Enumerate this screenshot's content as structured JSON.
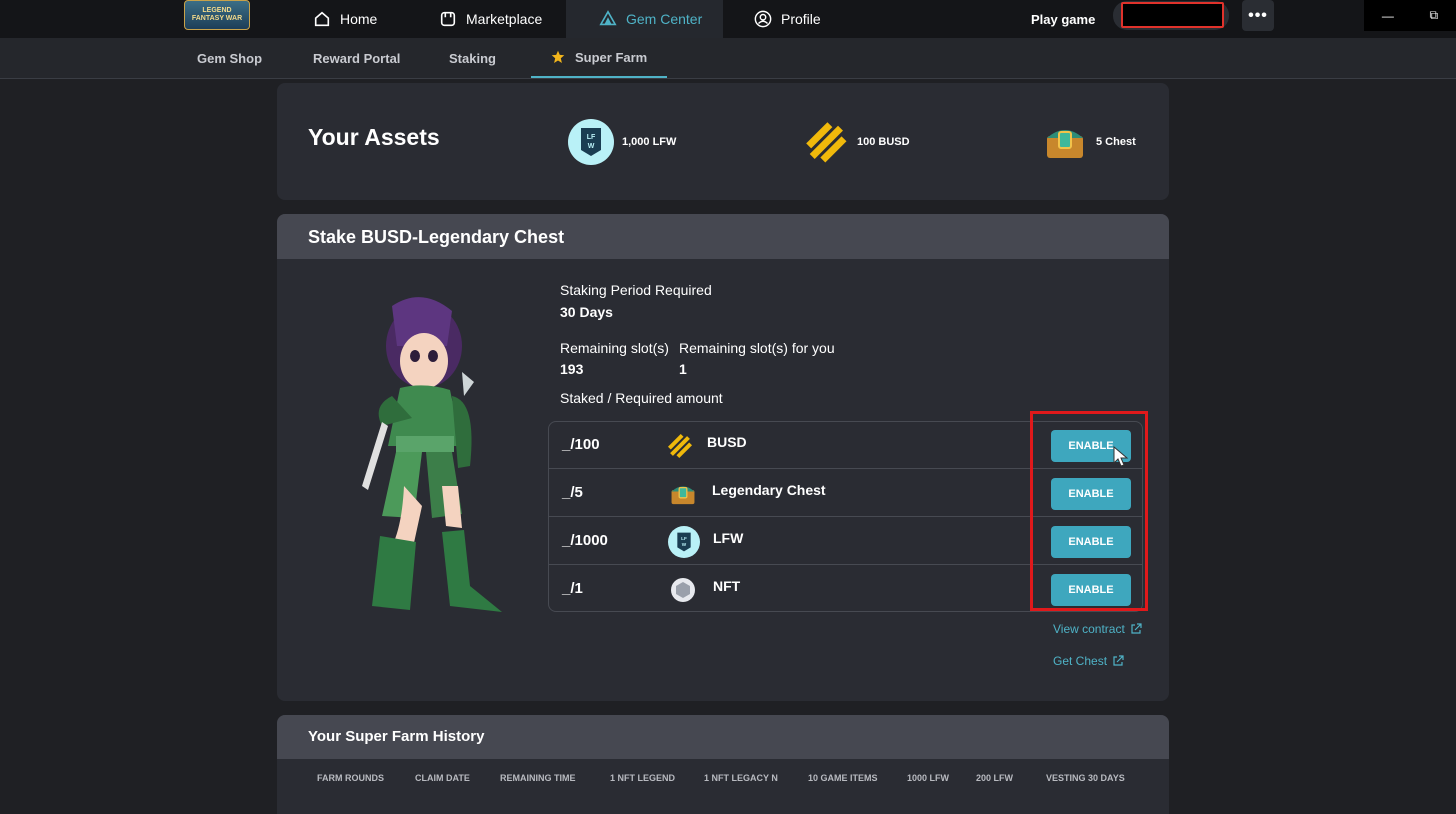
{
  "topbar": {
    "logo_text": "LEGEND FANTASY WAR",
    "nav": [
      {
        "label": "Home",
        "icon": "home-icon"
      },
      {
        "label": "Marketplace",
        "icon": "store-icon"
      },
      {
        "label": "Gem Center",
        "icon": "gem-icon",
        "active": true
      },
      {
        "label": "Profile",
        "icon": "user-icon"
      }
    ],
    "play_label": "Play game",
    "more_label": "•••",
    "window_controls": [
      "—",
      "⧉"
    ]
  },
  "subnav": {
    "items": [
      {
        "label": "Gem Shop"
      },
      {
        "label": "Reward Portal"
      },
      {
        "label": "Staking"
      },
      {
        "label": "Super Farm",
        "active": true,
        "icon": "star-icon"
      }
    ]
  },
  "assets": {
    "title": "Your Assets",
    "items": [
      {
        "label": "1,000 LFW",
        "icon": "lfw-icon"
      },
      {
        "label": "100 BUSD",
        "icon": "busd-icon"
      },
      {
        "label": "5 Chest",
        "icon": "chest-icon"
      }
    ]
  },
  "stake": {
    "title": "Stake BUSD-Legendary Chest",
    "period_label": "Staking Period Required",
    "period_value": "30 Days",
    "remaining_label": "Remaining slot(s)",
    "remaining_value": "193",
    "remaining_you_label": "Remaining slot(s) for you",
    "remaining_you_value": "1",
    "amount_label": "Staked / Required amount",
    "rows": [
      {
        "amount": "_/100",
        "name": "BUSD",
        "icon": "busd-icon",
        "button": "ENABLE"
      },
      {
        "amount": "_/5",
        "name": "Legendary Chest",
        "icon": "chest-icon",
        "button": "ENABLE"
      },
      {
        "amount": "_/1000",
        "name": "LFW",
        "icon": "lfw-icon",
        "button": "ENABLE"
      },
      {
        "amount": "_/1",
        "name": "NFT",
        "icon": "nft-icon",
        "button": "ENABLE"
      }
    ],
    "view_contract": "View contract",
    "get_chest": "Get Chest"
  },
  "history": {
    "title": "Your Super Farm History",
    "columns": [
      "FARM ROUNDS",
      "CLAIM DATE",
      "REMAINING TIME",
      "1 NFT LEGEND",
      "1 NFT LEGACY N",
      "10 GAME ITEMS",
      "1000 LFW",
      "200 LFW",
      "VESTING 30 DAYS"
    ]
  },
  "colors": {
    "accent": "#4fb3c7",
    "button": "#3ea7be",
    "highlight": "#e0191b",
    "busd": "#f0b90b"
  }
}
